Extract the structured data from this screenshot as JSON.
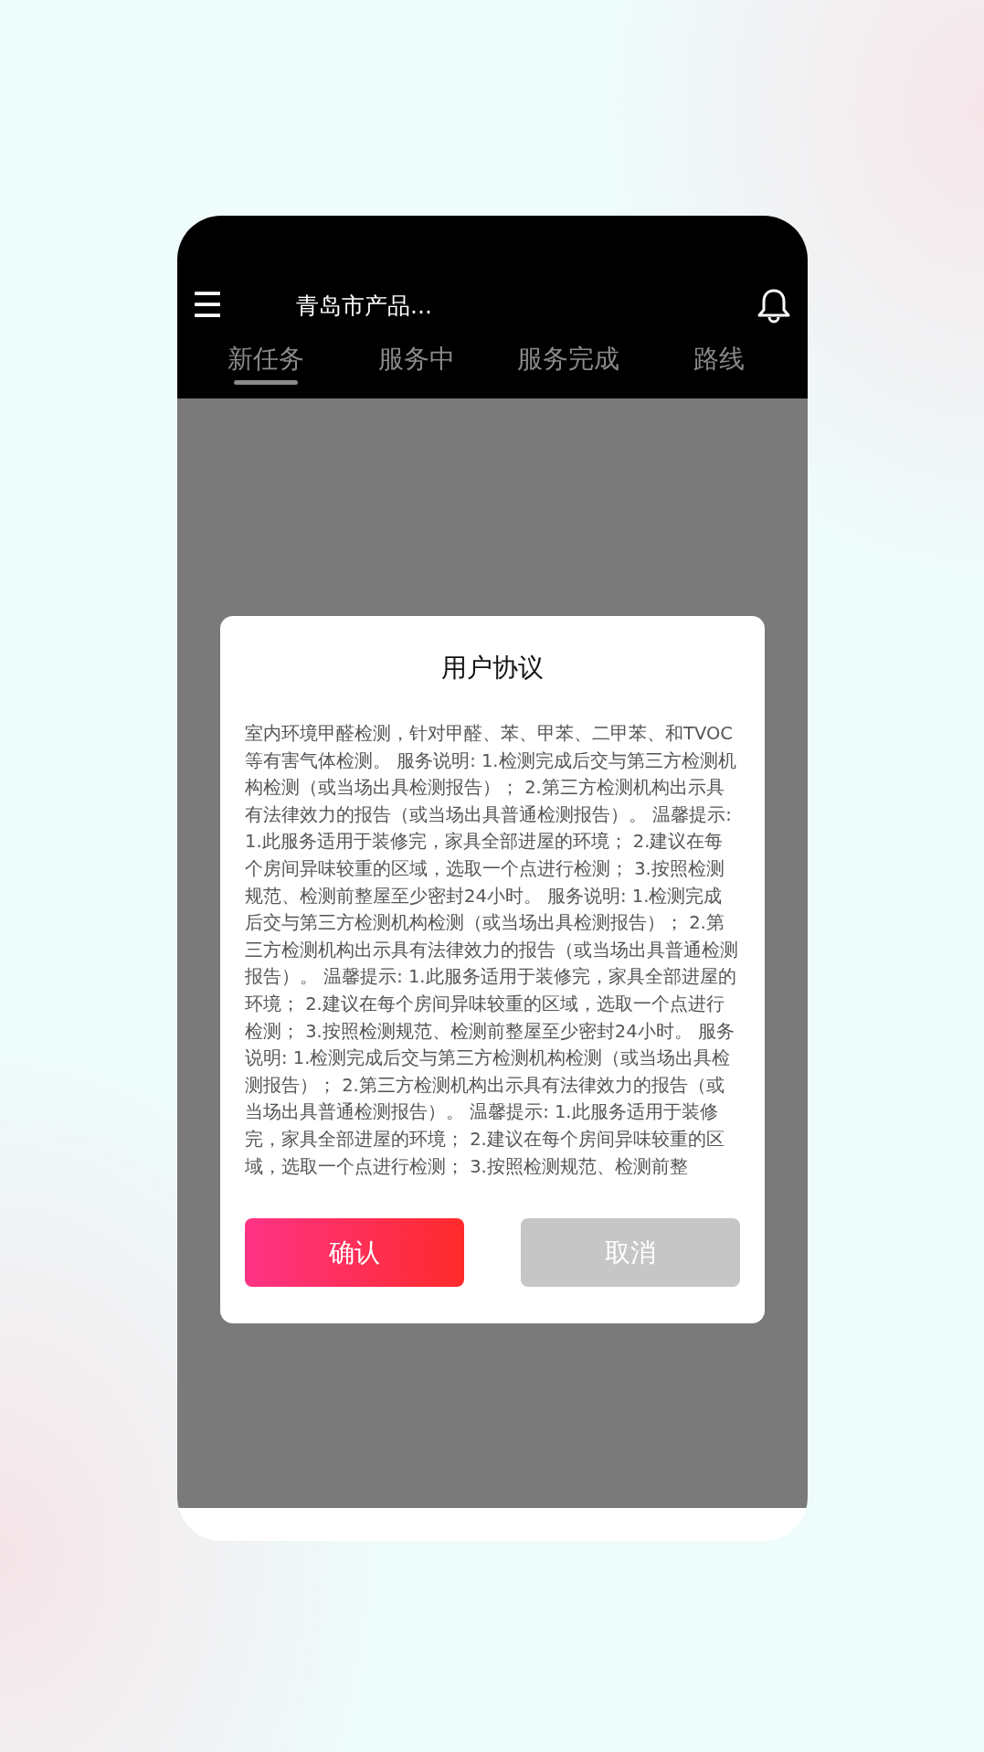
{
  "app_bar": {
    "menu_icon": "☰",
    "title": "青岛市产品..."
  },
  "tabs": [
    {
      "label": "新任务",
      "selected": true
    },
    {
      "label": "服务中",
      "selected": false
    },
    {
      "label": "服务完成",
      "selected": false
    },
    {
      "label": "路线",
      "selected": false
    }
  ],
  "dialog": {
    "title": "用户协议",
    "body": "室内环境甲醛检测，针对甲醛、苯、甲苯、二甲苯、和TVOC等有害气体检测。 服务说明: 1.检测完成后交与第三方检测机构检测（或当场出具检测报告）； 2.第三方检测机构出示具有法律效力的报告（或当场出具普通检测报告）。 温馨提示: 1.此服务适用于装修完，家具全部进屋的环境； 2.建议在每个房间异味较重的区域，选取一个点进行检测； 3.按照检测规范、检测前整屋至少密封24小时。 服务说明: 1.检测完成后交与第三方检测机构检测（或当场出具检测报告）； 2.第三方检测机构出示具有法律效力的报告（或当场出具普通检测报告）。 温馨提示: 1.此服务适用于装修完，家具全部进屋的环境； 2.建议在每个房间异味较重的区域，选取一个点进行检测； 3.按照检测规范、检测前整屋至少密封24小时。 服务说明: 1.检测完成后交与第三方检测机构检测（或当场出具检测报告）； 2.第三方检测机构出示具有法律效力的报告（或当场出具普通检测报告）。 温馨提示: 1.此服务适用于装修完，家具全部进屋的环境； 2.建议在每个房间异味较重的区域，选取一个点进行检测； 3.按照检测规范、检测前整",
    "buttons": [
      {
        "label": "确认",
        "kind": "primary"
      },
      {
        "label": "取消",
        "kind": "secondary"
      }
    ]
  }
}
